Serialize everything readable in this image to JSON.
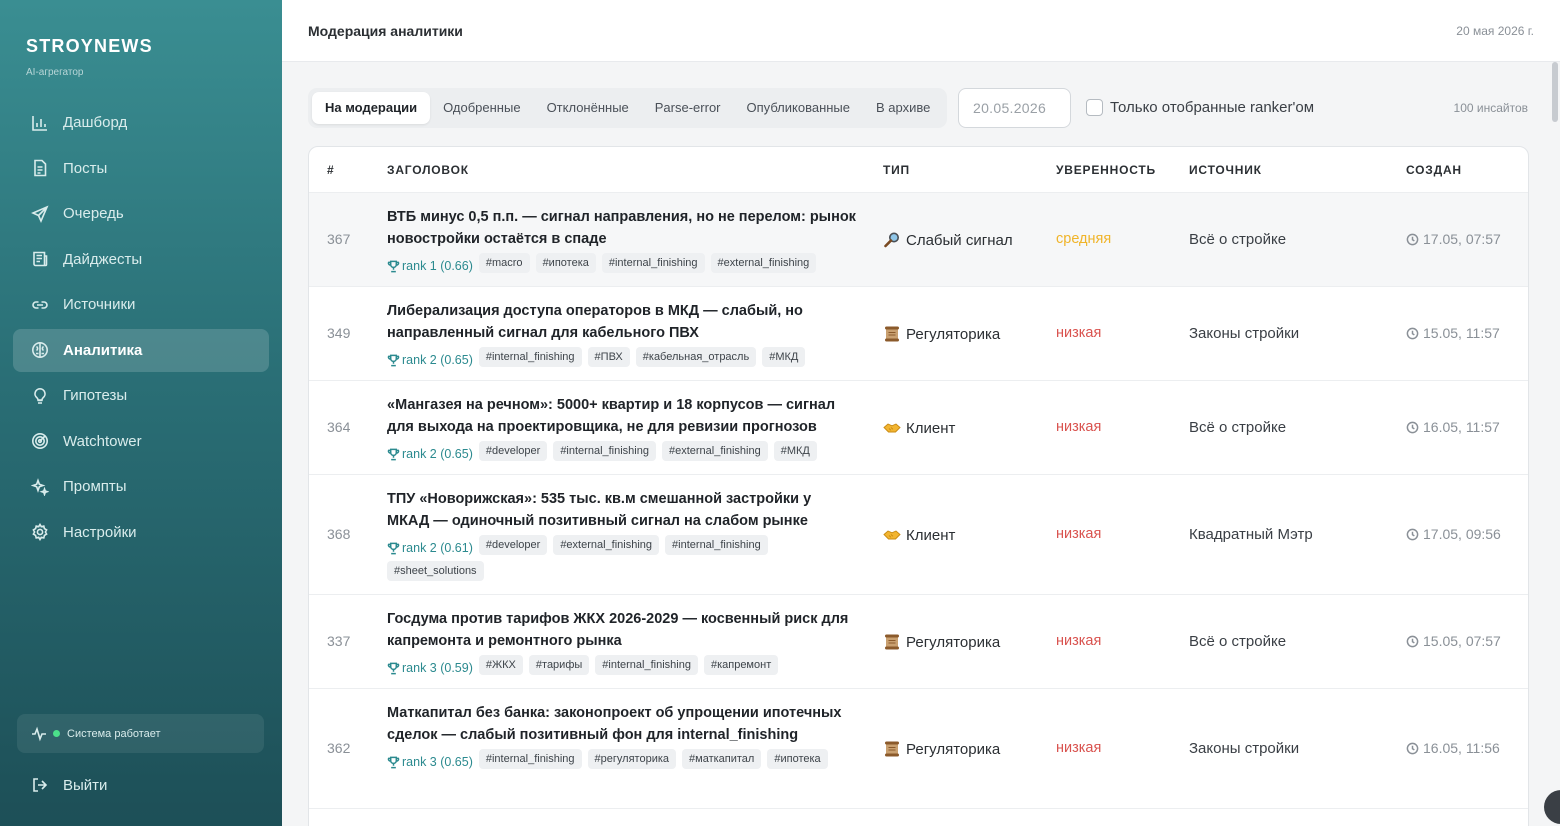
{
  "brand": {
    "name": "STROYNEWS",
    "subtitle": "AI-агрегатор"
  },
  "sidebar": {
    "items": [
      {
        "label": "Дашборд",
        "icon": "chart-bar-icon",
        "active": false
      },
      {
        "label": "Посты",
        "icon": "document-icon",
        "active": false
      },
      {
        "label": "Очередь",
        "icon": "send-icon",
        "active": false
      },
      {
        "label": "Дайджесты",
        "icon": "newspaper-icon",
        "active": false
      },
      {
        "label": "Источники",
        "icon": "link-icon",
        "active": false
      },
      {
        "label": "Аналитика",
        "icon": "brain-icon",
        "active": true
      },
      {
        "label": "Гипотезы",
        "icon": "lightbulb-icon",
        "active": false
      },
      {
        "label": "Watchtower",
        "icon": "radar-icon",
        "active": false
      },
      {
        "label": "Промпты",
        "icon": "sparkles-icon",
        "active": false
      },
      {
        "label": "Настройки",
        "icon": "gear-icon",
        "active": false
      }
    ],
    "status": "Система работает",
    "logout": "Выйти"
  },
  "header": {
    "title": "Модерация аналитики",
    "date": "20 мая 2026 г."
  },
  "filters": {
    "tabs": [
      {
        "label": "На модерации",
        "active": true
      },
      {
        "label": "Одобренные",
        "active": false
      },
      {
        "label": "Отклонённые",
        "active": false
      },
      {
        "label": "Parse-error",
        "active": false
      },
      {
        "label": "Опубликованные",
        "active": false
      },
      {
        "label": "В архиве",
        "active": false
      }
    ],
    "date_value": "20.05.2026",
    "only_ranked_label": "Только отобранные ranker'ом",
    "count": "100 инсайтов"
  },
  "table": {
    "headers": {
      "id": "#",
      "title": "ЗАГОЛОВОК",
      "type": "ТИП",
      "confidence": "УВЕРЕННОСТЬ",
      "source": "ИСТОЧНИК",
      "created": "СОЗДАН"
    },
    "colors": {
      "medium": "#f0b429",
      "low": "#d9534f"
    },
    "rows": [
      {
        "id": "367",
        "title": "ВТБ минус 0,5 п.п. — сигнал направления, но не перелом: рынок новостройки остаётся в спаде",
        "rank": "rank 1 (0.66)",
        "tags": [
          "#macro",
          "#ипотека",
          "#internal_finishing",
          "#external_finishing"
        ],
        "type": "Слабый сигнал",
        "type_icon": "magnifier-icon",
        "confidence": "средняя",
        "confidence_level": "medium",
        "source": "Всё о стройке",
        "created": "17.05, 07:57"
      },
      {
        "id": "349",
        "title": "Либерализация доступа операторов в МКД — слабый, но направленный сигнал для кабельного ПВХ",
        "rank": "rank 2 (0.65)",
        "tags": [
          "#internal_finishing",
          "#ПВХ",
          "#кабельная_отрасль",
          "#МКД"
        ],
        "type": "Регуляторика",
        "type_icon": "scroll-icon",
        "confidence": "низкая",
        "confidence_level": "low",
        "source": "Законы стройки",
        "created": "15.05, 11:57"
      },
      {
        "id": "364",
        "title": "«Мангазея на речном»: 5000+ квартир и 18 корпусов — сигнал для выхода на проектировщика, не для ревизии прогнозов",
        "rank": "rank 2 (0.65)",
        "tags": [
          "#developer",
          "#internal_finishing",
          "#external_finishing",
          "#МКД"
        ],
        "type": "Клиент",
        "type_icon": "handshake-icon",
        "confidence": "низкая",
        "confidence_level": "low",
        "source": "Всё о стройке",
        "created": "16.05, 11:57"
      },
      {
        "id": "368",
        "title": "ТПУ «Новорижская»: 535 тыс. кв.м смешанной застройки у МКАД — одиночный позитивный сигнал на слабом рынке",
        "rank": "rank 2 (0.61)",
        "tags": [
          "#developer",
          "#external_finishing",
          "#internal_finishing",
          "#sheet_solutions"
        ],
        "type": "Клиент",
        "type_icon": "handshake-icon",
        "confidence": "низкая",
        "confidence_level": "low",
        "source": "Квадратный Мэтр",
        "created": "17.05, 09:56"
      },
      {
        "id": "337",
        "title": "Госдума против тарифов ЖКХ 2026-2029 — косвенный риск для капремонта и ремонтного рынка",
        "rank": "rank 3 (0.59)",
        "tags": [
          "#ЖКХ",
          "#тарифы",
          "#internal_finishing",
          "#капремонт"
        ],
        "type": "Регуляторика",
        "type_icon": "scroll-icon",
        "confidence": "низкая",
        "confidence_level": "low",
        "source": "Всё о стройке",
        "created": "15.05, 07:57"
      },
      {
        "id": "362",
        "title": "Маткапитал без банка: законопроект об упрощении ипотечных сделок — слабый позитивный фон для internal_finishing",
        "rank": "rank 3 (0.65)",
        "tags": [
          "#internal_finishing",
          "#регуляторика",
          "#маткапитал",
          "#ипотека"
        ],
        "type": "Регуляторика",
        "type_icon": "scroll-icon",
        "confidence": "низкая",
        "confidence_level": "low",
        "source": "Законы стройки",
        "created": "16.05, 11:56"
      }
    ]
  }
}
